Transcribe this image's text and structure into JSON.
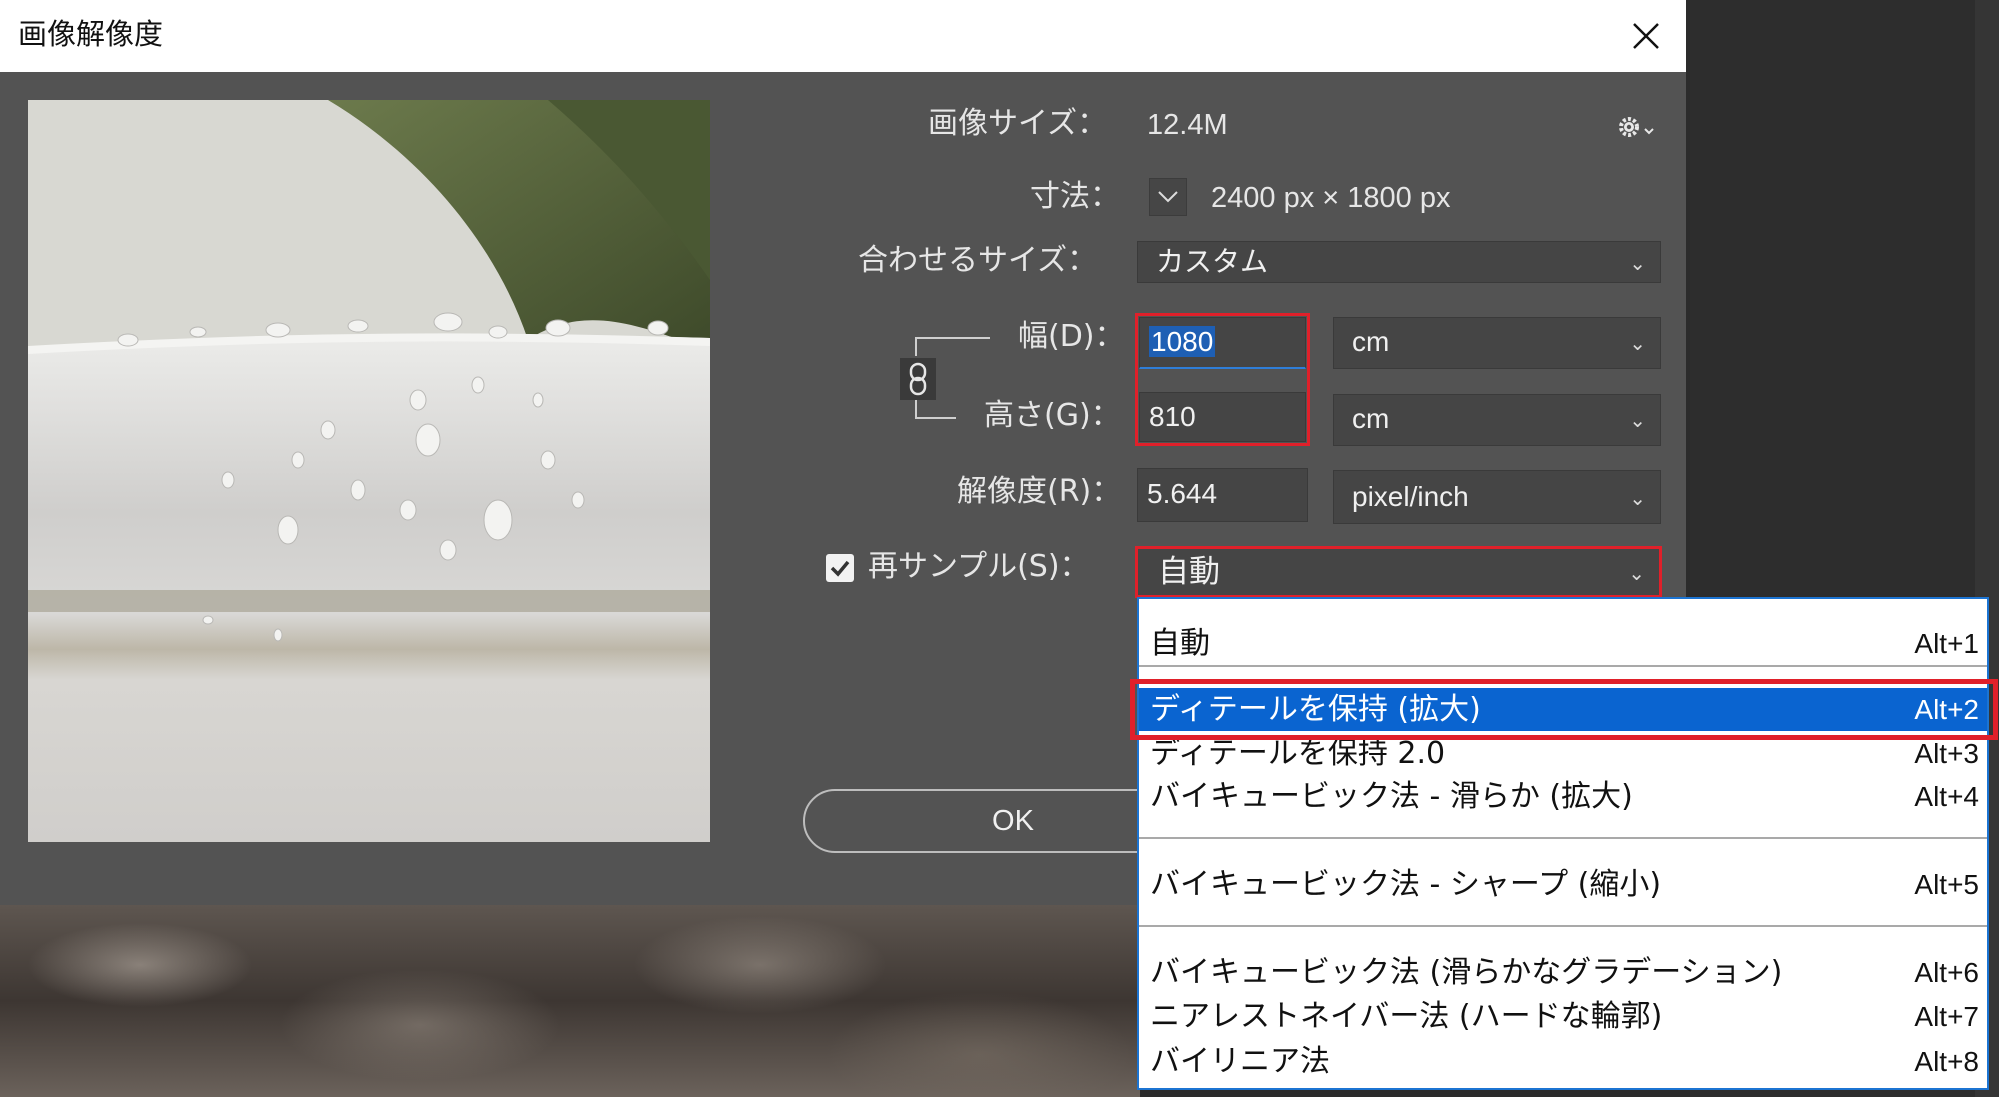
{
  "dialog": {
    "title": "画像解像度",
    "close_icon": "close-icon"
  },
  "info": {
    "image_size_label": "画像サイズ：",
    "image_size_value": "12.4M",
    "dimensions_label": "寸法：",
    "dimensions_value": "2400 px × 1800 px",
    "settings_icon": "gear-icon"
  },
  "fit_to": {
    "label": "合わせるサイズ：",
    "value": "カスタム"
  },
  "width": {
    "label": "幅(D)：",
    "value": "1080",
    "unit": "cm"
  },
  "height": {
    "label": "高さ(G)：",
    "value": "810",
    "unit": "cm"
  },
  "resolution": {
    "label": "解像度(R)：",
    "value": "5.644",
    "unit": "pixel/inch"
  },
  "resample": {
    "label": "再サンプル(S)：",
    "checked": true,
    "value": "自動"
  },
  "buttons": {
    "ok": "OK"
  },
  "menu": {
    "items": [
      {
        "label": "自動",
        "shortcut": "Alt+1"
      },
      {
        "label": "ディテールを保持 (拡大)",
        "shortcut": "Alt+2",
        "selected": true
      },
      {
        "label": "ディテールを保持 2.0",
        "shortcut": "Alt+3"
      },
      {
        "label": "バイキュービック法 - 滑らか (拡大)",
        "shortcut": "Alt+4"
      },
      {
        "label": "バイキュービック法 - シャープ (縮小)",
        "shortcut": "Alt+5"
      },
      {
        "label": "バイキュービック法 (滑らかなグラデーション)",
        "shortcut": "Alt+6"
      },
      {
        "label": "ニアレストネイバー法 (ハードな輪郭)",
        "shortcut": "Alt+7"
      },
      {
        "label": "バイリニア法",
        "shortcut": "Alt+8"
      }
    ]
  },
  "colors": {
    "dialog_bg": "#535353",
    "highlight_red": "#e0202a",
    "selection_blue": "#0a64d0"
  }
}
